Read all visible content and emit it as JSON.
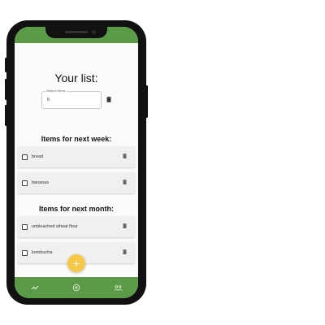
{
  "colors": {
    "primary_green": "#5b9b47",
    "fab_yellow": "#f6c84a",
    "card_background": "#f0f0f0",
    "screen_background": "#fbfbfb"
  },
  "header": {
    "title": "Your list:"
  },
  "search": {
    "label": "Search Items",
    "value": "b"
  },
  "sections": [
    {
      "title": "Items for next week:",
      "items": [
        {
          "label": "bread",
          "checked": false
        },
        {
          "label": "bananas",
          "checked": false
        }
      ]
    },
    {
      "title": "Items for next month:",
      "items": [
        {
          "label": "unbleached wheat flour",
          "checked": false
        },
        {
          "label": "kombucha",
          "checked": false
        }
      ]
    }
  ],
  "fab": {
    "icon": "plus-icon",
    "label": "+"
  },
  "bottom_nav": {
    "icons": [
      "analytics-icon",
      "add-circle-icon",
      "group-icon"
    ]
  }
}
